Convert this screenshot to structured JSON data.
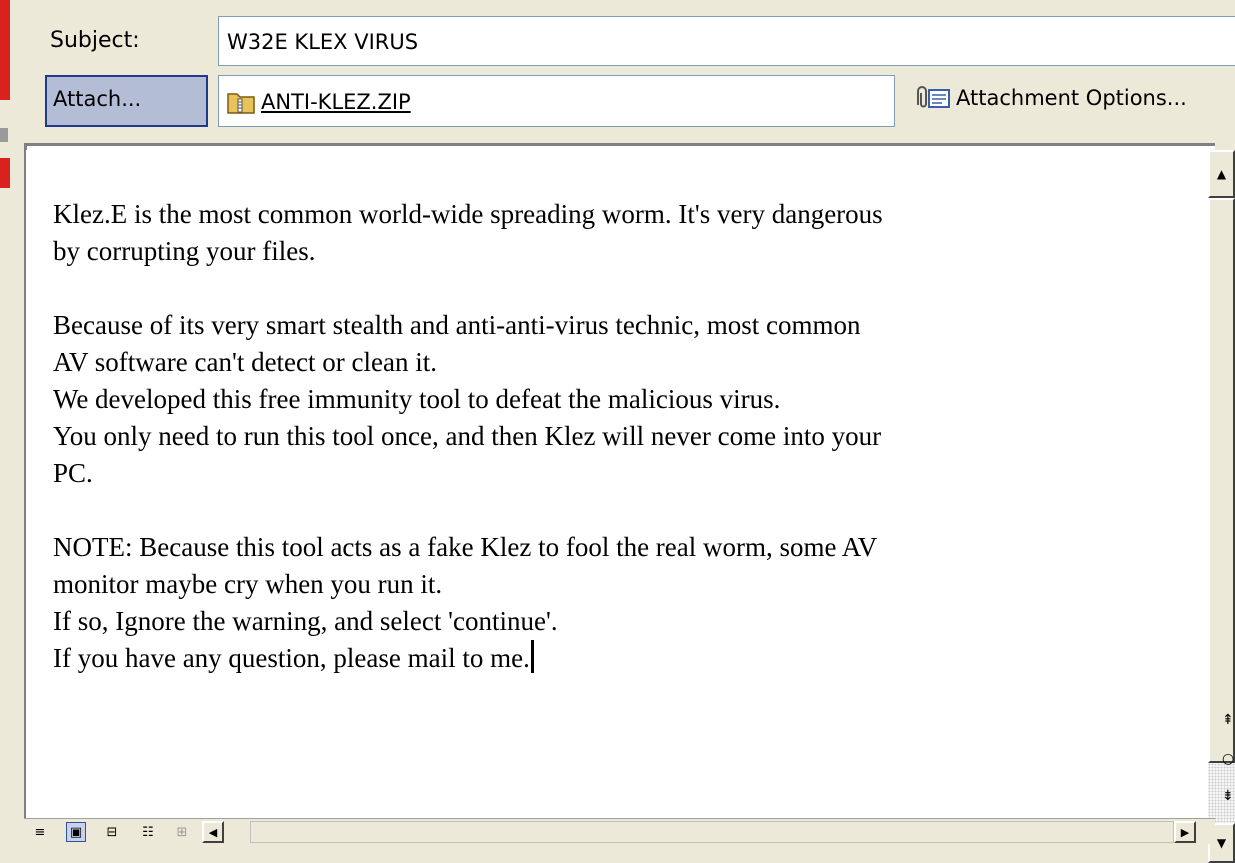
{
  "header": {
    "subject_label": "Subject:",
    "subject_value": "W32E KLEX VIRUS",
    "attach_button_label": "Attach...",
    "attachment": {
      "filename": "ANTI-KLEZ.ZIP",
      "icon": "zip-folder-icon"
    },
    "attachment_options_label": "Attachment Options...",
    "attachment_options_icon": "paperclip-icon"
  },
  "message": {
    "lines": [
      "Klez.E is the most common world-wide spreading worm. It's very dangerous",
      "by corrupting your files.",
      "",
      "Because of its very smart stealth and anti-anti-virus technic, most common",
      "AV software can't detect or clean it.",
      "We developed this free immunity tool to defeat the malicious virus.",
      "You only need to run this tool once, and then Klez will never come into your",
      "PC.",
      "",
      "NOTE: Because this tool acts as a fake Klez to fool the real worm, some AV",
      "monitor maybe cry when you run it.",
      "If so, Ignore the warning, and select 'continue'.",
      "If you have any question, please mail to me."
    ]
  },
  "view_buttons": [
    {
      "name": "normal-view-icon",
      "glyph": "≡",
      "active": false,
      "disabled": false
    },
    {
      "name": "web-layout-view-icon",
      "glyph": "▣",
      "active": true,
      "disabled": false
    },
    {
      "name": "print-layout-view-icon",
      "glyph": "⊟",
      "active": false,
      "disabled": false
    },
    {
      "name": "outline-view-icon",
      "glyph": "☷",
      "active": false,
      "disabled": false
    },
    {
      "name": "reading-view-icon",
      "glyph": "⊞",
      "active": false,
      "disabled": true
    }
  ],
  "scroll_glyphs": {
    "up": "▲",
    "down": "▼",
    "left": "◀",
    "right": "▶",
    "prev_page": "⇞",
    "select_browse_object": "○",
    "next_page": "⇟"
  },
  "colors": {
    "chrome": "#ece9d8",
    "field_border": "#7f9db9",
    "attach_button_bg": "#b3bdd6",
    "attach_button_border": "#1f3a8a"
  }
}
